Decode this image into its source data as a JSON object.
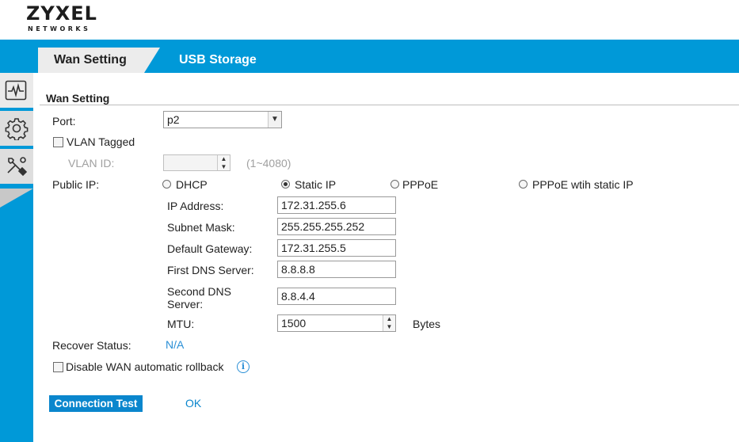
{
  "brand": {
    "name": "ZYXEL",
    "sub": "NETWORKS"
  },
  "tabs": [
    {
      "label": "Wan Setting",
      "active": true
    },
    {
      "label": "USB Storage",
      "active": false
    }
  ],
  "sidebar": [
    {
      "icon": "monitor-pulse-icon",
      "active": true
    },
    {
      "icon": "gear-icon",
      "active": false
    },
    {
      "icon": "tools-icon",
      "active": false
    }
  ],
  "section_title": "Wan Setting",
  "port": {
    "label": "Port:",
    "value": "p2"
  },
  "vlan_tagged": {
    "label": "VLAN Tagged",
    "checked": false
  },
  "vlan_id": {
    "label": "VLAN ID:",
    "value": "",
    "range": "(1~4080)"
  },
  "public_ip": {
    "label": "Public IP:",
    "options": [
      "DHCP",
      "Static IP",
      "PPPoE",
      "PPPoE wtih static IP"
    ],
    "selected": "Static IP"
  },
  "static_fields": {
    "ip_address": {
      "label": "IP Address:",
      "value": "172.31.255.6"
    },
    "subnet_mask": {
      "label": "Subnet Mask:",
      "value": "255.255.255.252"
    },
    "default_gateway": {
      "label": "Default Gateway:",
      "value": "172.31.255.5"
    },
    "first_dns": {
      "label": "First DNS Server:",
      "value": "8.8.8.8"
    },
    "second_dns": {
      "label_line1": "Second DNS",
      "label_line2": "Server:",
      "value": "8.8.4.4"
    },
    "mtu": {
      "label": "MTU:",
      "value": "1500",
      "unit": "Bytes"
    }
  },
  "recover_status": {
    "label": "Recover Status:",
    "value": "N/A"
  },
  "disable_rollback": {
    "label": "Disable WAN automatic rollback",
    "checked": false
  },
  "actions": {
    "connection_test": "Connection Test",
    "ok": "OK"
  },
  "colors": {
    "brand_blue": "#0099d8",
    "button_blue": "#0a86cd",
    "link_blue": "#2a8fd6"
  }
}
